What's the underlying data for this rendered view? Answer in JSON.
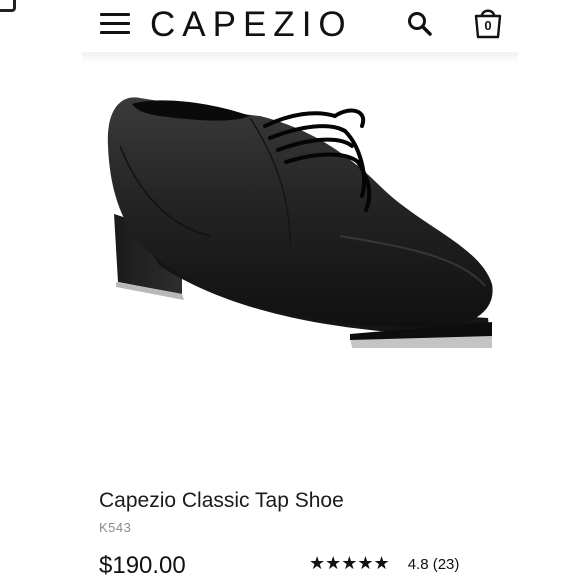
{
  "header": {
    "logo": "CAPEZIO",
    "menu_icon": "hamburger-menu-icon",
    "search_icon": "search-icon",
    "cart_icon": "shopping-bag-icon",
    "cart_count": "0"
  },
  "product": {
    "image_icon": "black-tap-shoe-image",
    "title": "Capezio Classic Tap Shoe",
    "sku": "K543",
    "price": "$190.00",
    "rating_stars": "★★★★★",
    "rating_text": "4.8 (23)",
    "rating_value": 4.8
  },
  "colors": {
    "text": "#111111",
    "muted": "#8a8a8a",
    "background": "#ffffff"
  }
}
